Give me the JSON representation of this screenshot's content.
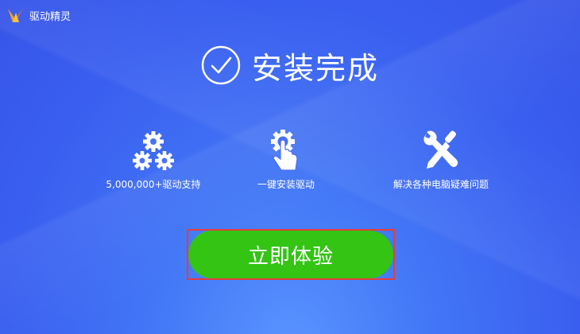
{
  "app": {
    "title": "驱动精灵",
    "icon": "sprite-logo-icon"
  },
  "status": {
    "title": "安装完成",
    "icon": "check-circle-icon"
  },
  "features": [
    {
      "label": "5,000,000+驱动支持",
      "icon": "gears-icon"
    },
    {
      "label": "一键安装驱动",
      "icon": "hand-click-gear-icon"
    },
    {
      "label": "解决各种电脑疑难问题",
      "icon": "wrench-screwdriver-icon"
    }
  ],
  "cta": {
    "label": "立即体验"
  },
  "colors": {
    "background": "#3a5ff0",
    "button": "#33c414",
    "highlight_frame": "#e83b3b"
  }
}
